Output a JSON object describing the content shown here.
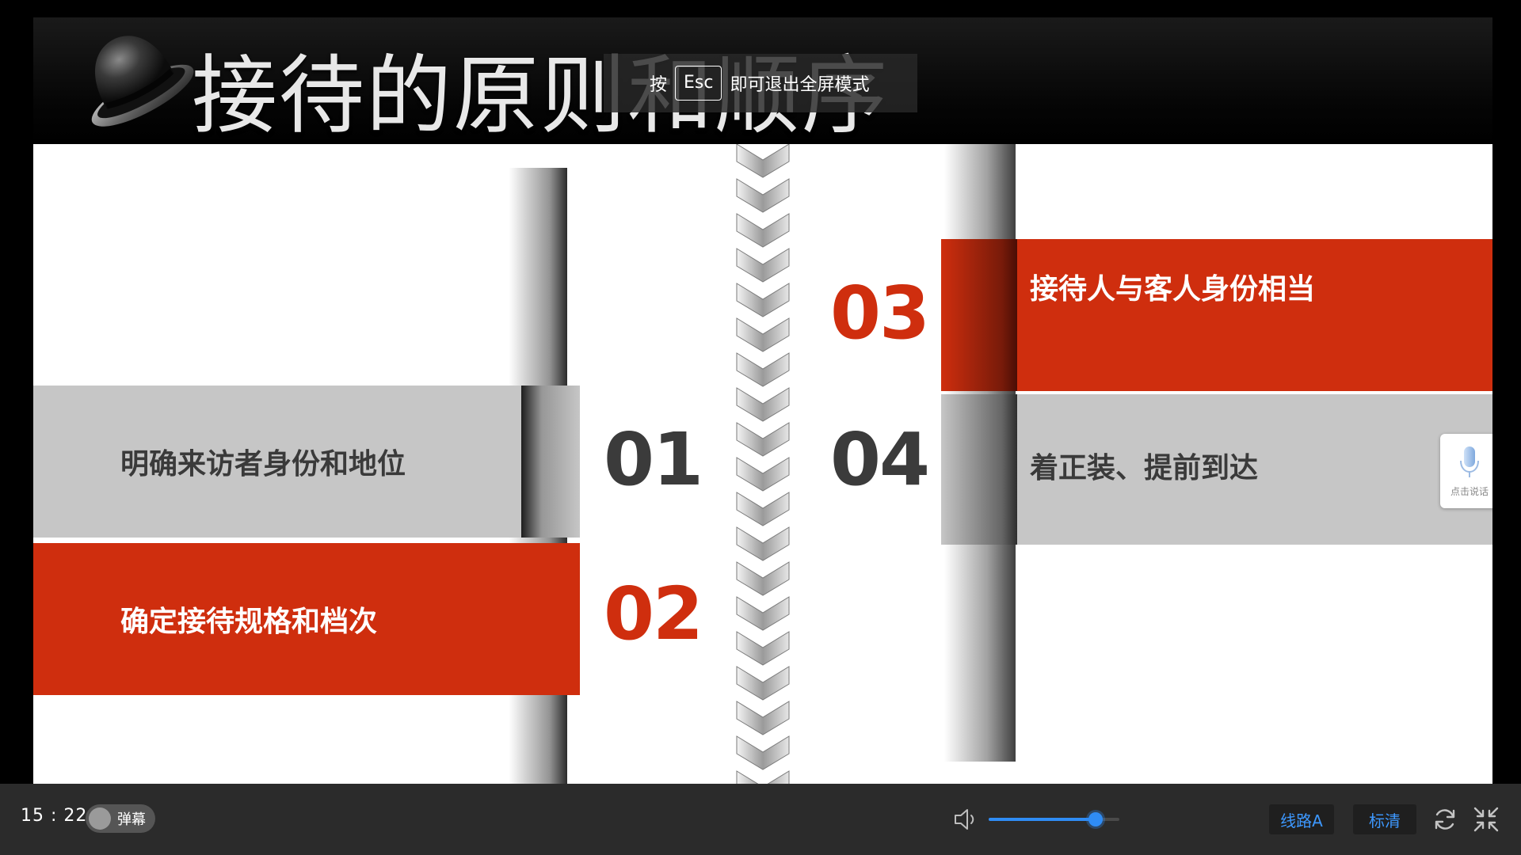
{
  "slide": {
    "title": "接待的原则和顺序",
    "items": [
      {
        "number": "01",
        "text": "明确来访者身份和地位"
      },
      {
        "number": "02",
        "text": "确定接待规格和档次"
      },
      {
        "number": "03",
        "text": "接待人与客人身份相当"
      },
      {
        "number": "04",
        "text": "着正装、提前到达"
      }
    ]
  },
  "esc_hint": {
    "prefix": "按",
    "key": "Esc",
    "suffix": "即可退出全屏模式"
  },
  "mic": {
    "label": "点击说话",
    "icon": "microphone-icon"
  },
  "controls": {
    "time": "15 : 22",
    "danmaku_label": "弹幕",
    "volume_level": 0.82,
    "line_label": "线路A",
    "quality_label": "标清",
    "icons": [
      "volume-icon",
      "refresh-icon",
      "exit-fullscreen-icon"
    ]
  },
  "colors": {
    "accent_red": "#cf2e0e",
    "band_grey": "#c6c6c6",
    "control_blue": "#2f8cf5"
  }
}
